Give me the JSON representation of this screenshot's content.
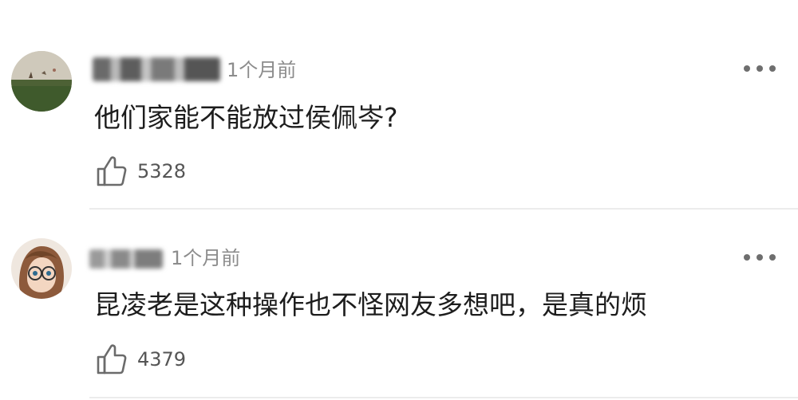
{
  "comments": [
    {
      "time": "1个月前",
      "content": "他们家能不能放过侯佩岑?",
      "likes": "5328",
      "avatar": "landscape-avatar-icon"
    },
    {
      "time": "1个月前",
      "content": "昆凌老是这种操作也不怪网友多想吧，是真的烦",
      "likes": "4379",
      "avatar": "anime-character-avatar-icon"
    }
  ],
  "colors": {
    "text": "#1d1d1d",
    "meta": "#8c8c8c",
    "divider": "#ececec"
  }
}
